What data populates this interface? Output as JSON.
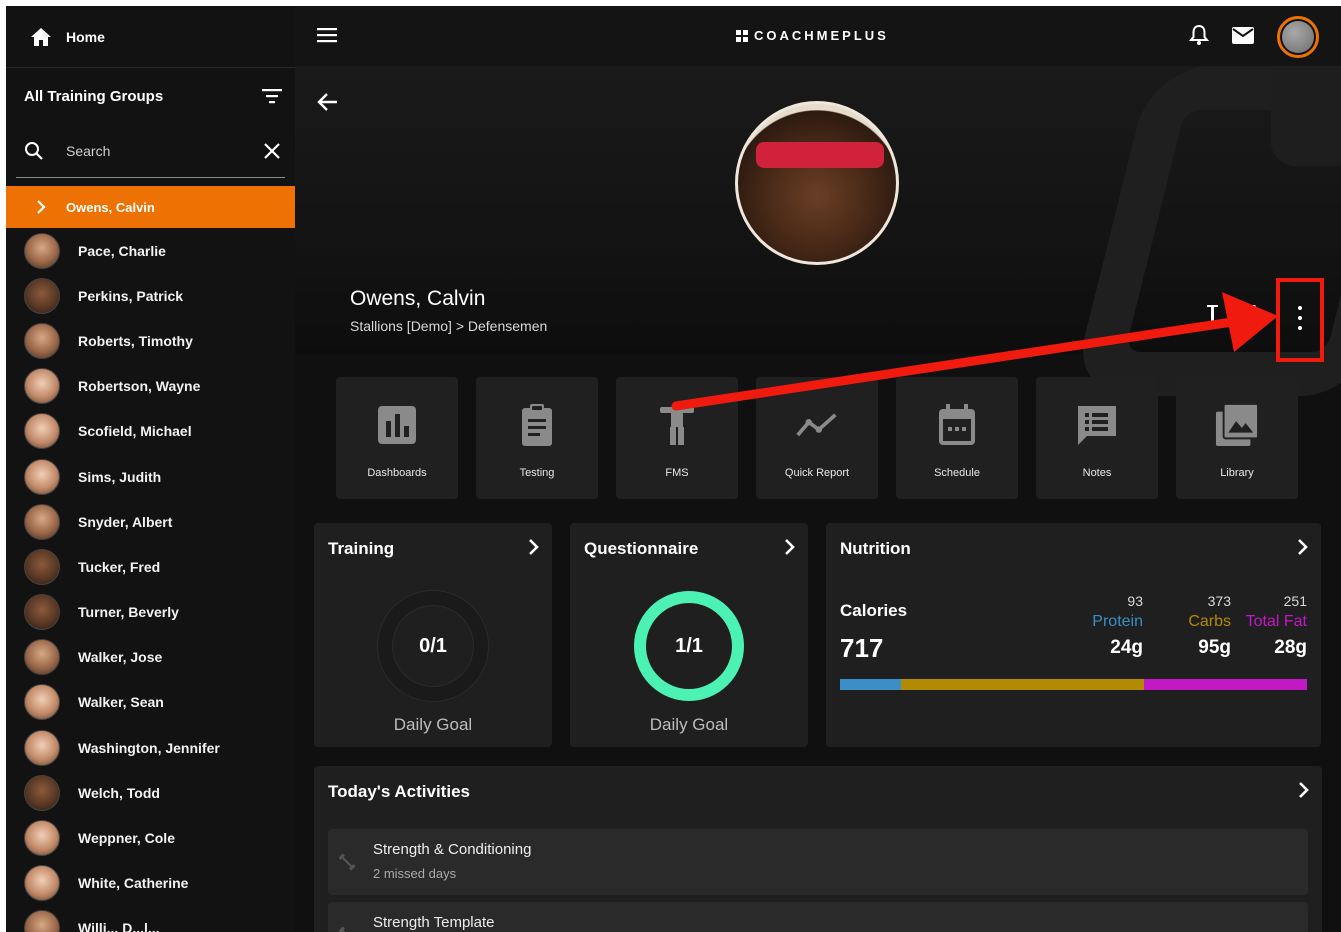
{
  "sidebar": {
    "home_label": "Home",
    "groups_label": "All Training Groups",
    "search_placeholder": "Search",
    "active_athlete": "Owens, Calvin",
    "athletes": [
      {
        "name": "Pace, Charlie"
      },
      {
        "name": "Perkins, Patrick"
      },
      {
        "name": "Roberts, Timothy"
      },
      {
        "name": "Robertson, Wayne"
      },
      {
        "name": "Scofield, Michael"
      },
      {
        "name": "Sims, Judith"
      },
      {
        "name": "Snyder, Albert"
      },
      {
        "name": "Tucker, Fred"
      },
      {
        "name": "Turner, Beverly"
      },
      {
        "name": "Walker, Jose"
      },
      {
        "name": "Walker, Sean"
      },
      {
        "name": "Washington, Jennifer"
      },
      {
        "name": "Welch, Todd"
      },
      {
        "name": "Weppner, Cole"
      },
      {
        "name": "White, Catherine"
      },
      {
        "name": "Willi...  D...l..."
      }
    ]
  },
  "header": {
    "brand": "COACHMEPLUS",
    "icons": [
      "menu-icon",
      "bell-icon",
      "mail-icon",
      "user-avatar"
    ],
    "accent": "#ee7203"
  },
  "profile": {
    "name": "Owens, Calvin",
    "group": "Stallions [Demo] > Defensemen"
  },
  "tiles": [
    {
      "label": "Dashboards",
      "icon": "bar-chart-icon"
    },
    {
      "label": "Testing",
      "icon": "clipboard-icon"
    },
    {
      "label": "FMS",
      "icon": "body-icon"
    },
    {
      "label": "Quick Report",
      "icon": "trend-line-icon"
    },
    {
      "label": "Schedule",
      "icon": "calendar-icon"
    },
    {
      "label": "Notes",
      "icon": "notes-icon"
    },
    {
      "label": "Library",
      "icon": "gallery-icon"
    }
  ],
  "training": {
    "title": "Training",
    "value": "0/1",
    "subtitle": "Daily Goal",
    "progress": 0
  },
  "questionnaire": {
    "title": "Questionnaire",
    "value": "1/1",
    "subtitle": "Daily Goal",
    "progress": 1,
    "ring_color": "#4cf2b4"
  },
  "nutrition": {
    "title": "Nutrition",
    "calories_label": "Calories",
    "calories_value": "717",
    "macros": [
      {
        "calories": "93",
        "name": "Protein",
        "grams": "24g",
        "color": "#3a8fc6"
      },
      {
        "calories": "373",
        "name": "Carbs",
        "grams": "95g",
        "color": "#b38b00"
      },
      {
        "calories": "251",
        "name": "Total Fat",
        "grams": "28g",
        "color": "#c218c6"
      }
    ]
  },
  "activities": {
    "title": "Today's Activities",
    "items": [
      {
        "title": "Strength & Conditioning",
        "subtitle": "2 missed days"
      },
      {
        "title": "Strength Template",
        "subtitle": ""
      }
    ]
  },
  "annotation": {
    "color": "#f01a0f"
  }
}
